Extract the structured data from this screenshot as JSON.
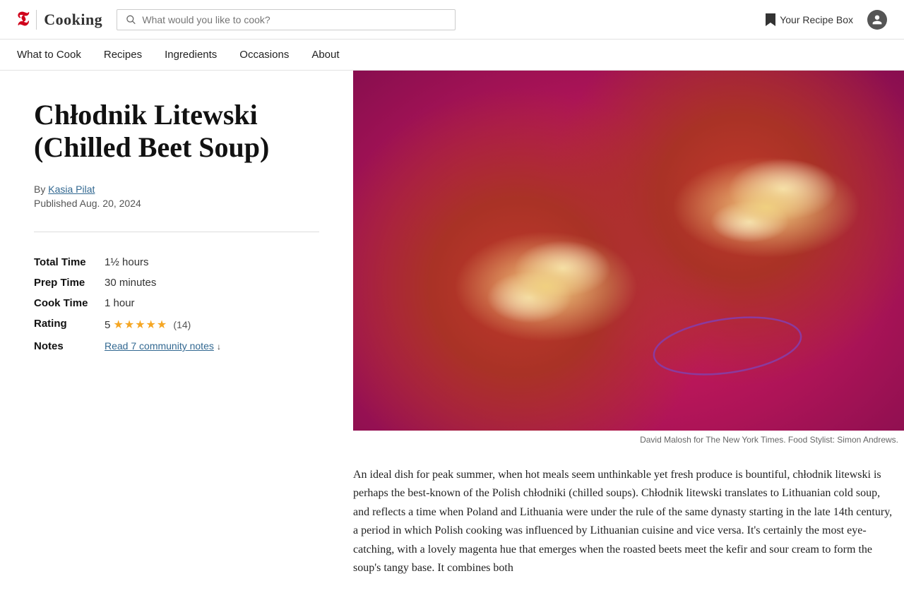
{
  "header": {
    "logo_nyt": "The New York Times",
    "logo_cooking": "Cooking",
    "search_placeholder": "What would you like to cook?",
    "recipe_box_label": "Your Recipe Box"
  },
  "nav": {
    "items": [
      {
        "label": "What to Cook",
        "href": "#"
      },
      {
        "label": "Recipes",
        "href": "#"
      },
      {
        "label": "Ingredients",
        "href": "#"
      },
      {
        "label": "Occasions",
        "href": "#"
      },
      {
        "label": "About",
        "href": "#"
      }
    ]
  },
  "recipe": {
    "title": "Chłodnik Litewski\n(Chilled Beet Soup)",
    "title_line1": "Chłodnik Litewski",
    "title_line2": "(Chilled Beet Soup)",
    "author_prefix": "By ",
    "author": "Kasia Pilat",
    "published": "Published Aug. 20, 2024",
    "meta": {
      "total_time_label": "Total Time",
      "total_time_value": "1½ hours",
      "prep_time_label": "Prep Time",
      "prep_time_value": "30 minutes",
      "cook_time_label": "Cook Time",
      "cook_time_value": "1 hour",
      "rating_label": "Rating",
      "rating_value": "5",
      "rating_stars": "★★★★★",
      "rating_count": "(14)",
      "notes_label": "Notes",
      "notes_link": "Read 7 community notes"
    },
    "image_caption": "David Malosh for The New York Times. Food Stylist: Simon Andrews.",
    "article_text": "An ideal dish for peak summer, when hot meals seem unthinkable yet fresh produce is bountiful, chłodnik litewski is perhaps the best-known of the Polish chłodniki (chilled soups). Chłodnik litewski translates to Lithuanian cold soup, and reflects a time when Poland and Lithuania were under the rule of the same dynasty starting in the late 14th century, a period in which Polish cooking was influenced by Lithuanian cuisine and vice versa. It's certainly the most eye-catching, with a lovely magenta hue that emerges when the roasted beets meet the kefir and sour cream to form the soup's tangy base. It combines both"
  }
}
